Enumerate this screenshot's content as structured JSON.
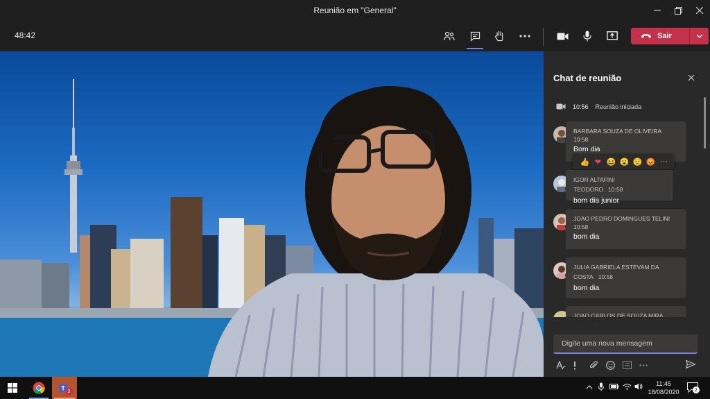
{
  "window": {
    "title": "Reunião em \"General\""
  },
  "toolbar": {
    "timer": "48:42",
    "leave_label": "Sair"
  },
  "chat": {
    "title": "Chat de reunião",
    "system": {
      "time": "10:56",
      "text": "Reunião iniciada"
    },
    "messages": [
      {
        "author": "BARBARA SOUZA DE OLIVEIRA",
        "time": "10:58",
        "text": "Bom dia"
      },
      {
        "author": "IGOR ALTAFINI TEODORO",
        "time": "10:58",
        "text": "bom dia junior"
      },
      {
        "author": "JOAO PEDRO DOMINGUES TELINI",
        "time": "10:58",
        "text": "bom dia"
      },
      {
        "author": "JULIA GABRIELA ESTEVAM DA COSTA",
        "time": "10:58",
        "text": "bom dia"
      },
      {
        "author": "JOAO CARLOS DE SOUZA MIRA",
        "time": "",
        "text": ""
      }
    ],
    "reactions": [
      "👍",
      "❤",
      "😆",
      "😮",
      "😟",
      "😡",
      "···"
    ],
    "compose_placeholder": "Digite uma nova mensagem"
  },
  "taskbar": {
    "time": "11:45",
    "date": "18/08/2020",
    "teams_badge": "2",
    "notification_count": "2"
  },
  "colors": {
    "accent": "#7b83eb",
    "leave": "#c4314b",
    "presence": "#6bb700"
  }
}
